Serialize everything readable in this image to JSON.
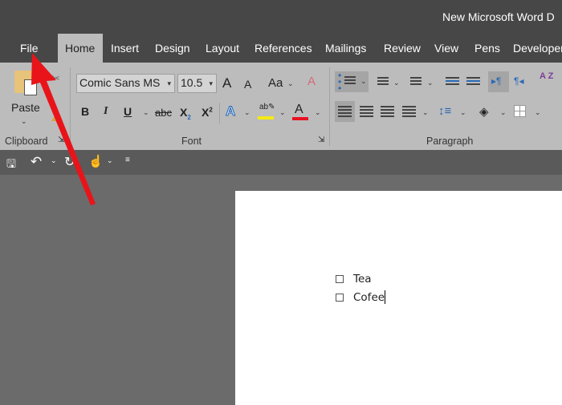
{
  "window": {
    "title": "New Microsoft Word D"
  },
  "tabs": [
    {
      "label": "File"
    },
    {
      "label": "Home",
      "active": true
    },
    {
      "label": "Insert"
    },
    {
      "label": "Design"
    },
    {
      "label": "Layout"
    },
    {
      "label": "References"
    },
    {
      "label": "Mailings"
    },
    {
      "label": "Review"
    },
    {
      "label": "View"
    },
    {
      "label": "Pens"
    },
    {
      "label": "Developer"
    }
  ],
  "ribbon": {
    "clipboard": {
      "paste_label": "Paste",
      "group_label": "Clipboard"
    },
    "font": {
      "font_name": "Comic Sans MS",
      "font_size": "10.5",
      "group_label": "Font",
      "bold": "B",
      "italic": "I",
      "underline": "U",
      "strike": "abc",
      "sub": "X",
      "sup": "X",
      "grow": "A",
      "shrink": "A",
      "case": "Aa",
      "text_effect": "A",
      "font_color": "A",
      "highlight_color": "#f5ea14",
      "font_color_value": "#e81123"
    },
    "paragraph": {
      "group_label": "Paragraph",
      "sort": "A Z"
    }
  },
  "document": {
    "items": [
      {
        "text": "Tea",
        "checked": false
      },
      {
        "text": "Cofee",
        "checked": false
      }
    ]
  },
  "annotation": {
    "arrow_color": "#e8141a",
    "points_to": "File"
  }
}
